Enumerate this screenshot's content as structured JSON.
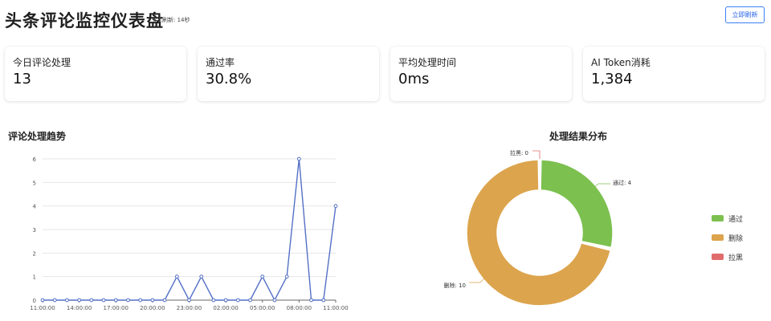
{
  "header": {
    "title": "头条评论监控仪表盘",
    "refresh_hint": "下次刷新: 14秒",
    "refresh_button": "立即刷新"
  },
  "stats": [
    {
      "label": "今日评论处理",
      "value": "13"
    },
    {
      "label": "通过率",
      "value": "30.8%"
    },
    {
      "label": "平均处理时间",
      "value": "0ms"
    },
    {
      "label": "AI Token消耗",
      "value": "1,384"
    }
  ],
  "trend": {
    "title": "评论处理趋势"
  },
  "pie": {
    "title": "处理结果分布"
  },
  "colors": {
    "line": "#5470c6",
    "pass": "#7cc04f",
    "delete": "#dca44d",
    "block": "#e06c6c",
    "accent": "#2563eb"
  },
  "chart_data": [
    {
      "type": "line",
      "title": "评论处理趋势",
      "x_ticks": [
        "11:00:00",
        "14:00:00",
        "17:00:00",
        "20:00:00",
        "23:00:00",
        "02:00:00",
        "05:00:00",
        "08:00:00",
        "11:00:00"
      ],
      "x": [
        "11:00",
        "12:00",
        "13:00",
        "14:00",
        "15:00",
        "16:00",
        "17:00",
        "18:00",
        "19:00",
        "20:00",
        "21:00",
        "22:00",
        "23:00",
        "00:00",
        "01:00",
        "02:00",
        "03:00",
        "04:00",
        "05:00",
        "06:00",
        "07:00",
        "08:00",
        "09:00",
        "10:00",
        "11:00"
      ],
      "values": [
        0,
        0,
        0,
        0,
        0,
        0,
        0,
        0,
        0,
        0,
        0,
        1,
        0,
        1,
        0,
        0,
        0,
        0,
        1,
        0,
        1,
        6,
        0,
        0,
        4
      ],
      "y_ticks": [
        0,
        1,
        2,
        3,
        4,
        5,
        6
      ],
      "ylim": [
        0,
        6
      ],
      "grid": true
    },
    {
      "type": "pie",
      "title": "处理结果分布",
      "slices": [
        {
          "name": "通过",
          "value": 4,
          "label": "通过: 4",
          "color": "#7cc04f"
        },
        {
          "name": "删除",
          "value": 10,
          "label": "删除: 10",
          "color": "#dca44d"
        },
        {
          "name": "拉黑",
          "value": 0,
          "label": "拉黑: 0",
          "color": "#e06c6c"
        }
      ],
      "legend": "right"
    }
  ]
}
